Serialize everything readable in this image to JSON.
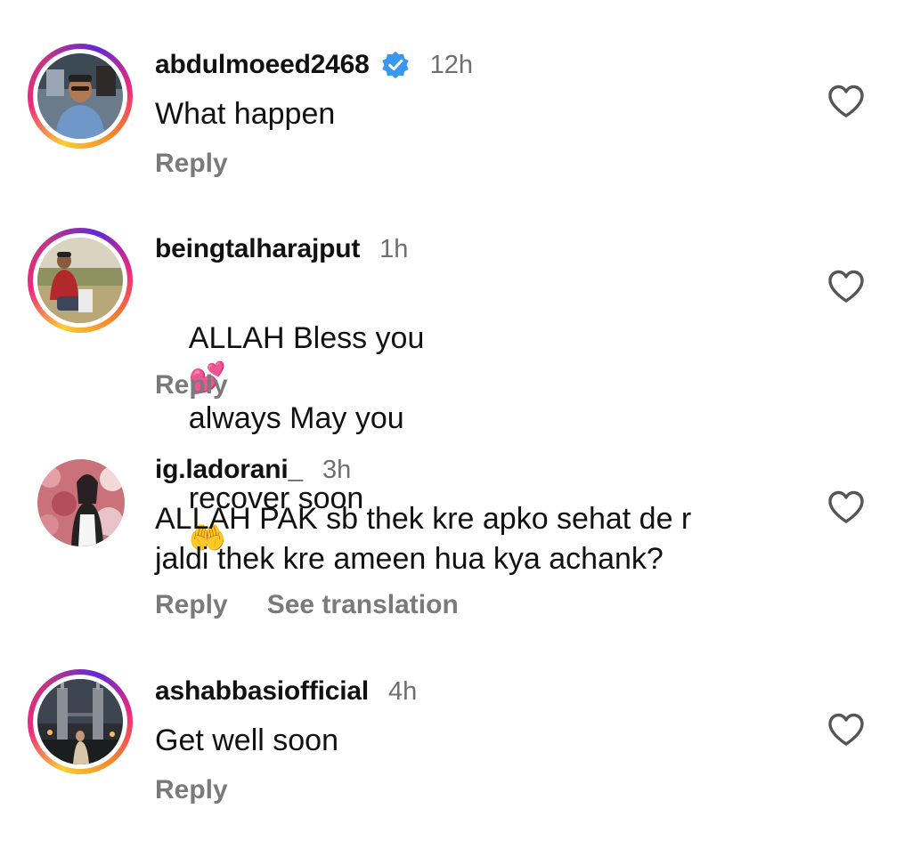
{
  "comments": [
    {
      "username": "abdulmoeed2468",
      "verified": true,
      "time": "12h",
      "text": "What happen",
      "reply_label": "Reply",
      "story_ring": true,
      "liked": false
    },
    {
      "username": "beingtalharajput",
      "verified": false,
      "time": "1h",
      "text_line1_a": "ALLAH Bless you",
      "emoji_hearts": "💕",
      "text_line1_b": "always May you",
      "text_line2": "recover soon",
      "emoji_hands": "🤲",
      "reply_label": "Reply",
      "story_ring": true,
      "liked": false
    },
    {
      "username": "ig.ladorani_",
      "verified": false,
      "time": "3h",
      "text": "ALLAH PAK sb thek kre apko sehat de r\njaldi thek kre ameen hua kya achank?",
      "reply_label": "Reply",
      "translation_label": "See translation",
      "story_ring": false,
      "liked": false
    },
    {
      "username": "ashabbasiofficial",
      "verified": false,
      "time": "4h",
      "text": "Get well soon",
      "reply_label": "Reply",
      "story_ring": true,
      "liked": false
    }
  ],
  "icons": {
    "like": "heart-outline-icon",
    "verified": "verified-badge-icon"
  },
  "colors": {
    "username": "#111111",
    "meta": "#6f6f6f",
    "action": "#7a7a7a",
    "verified": "#3897f0",
    "ring_start": "#f9ce34",
    "ring_mid": "#ee2a7b",
    "ring_end": "#6228d7"
  }
}
